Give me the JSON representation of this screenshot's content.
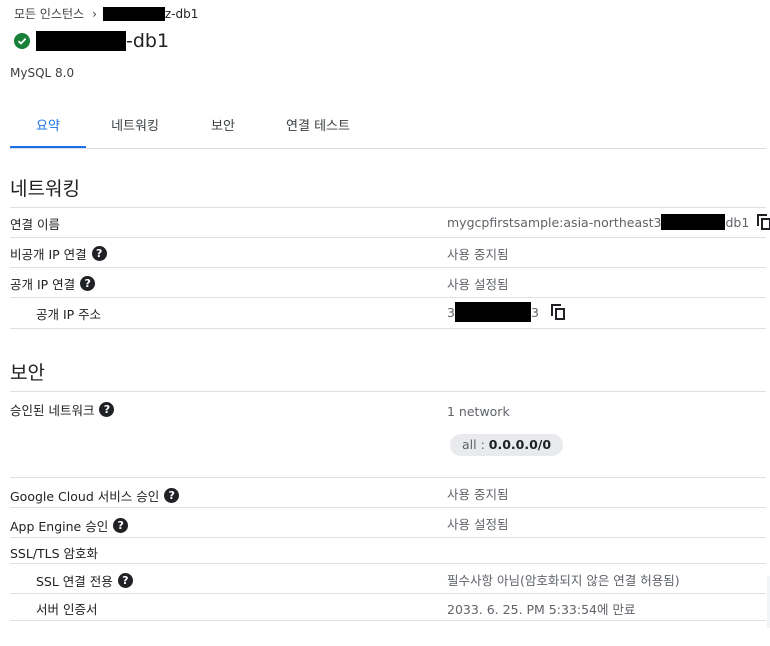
{
  "breadcrumb": {
    "root": "모든 인스턴스",
    "separator": "›",
    "current_suffix": "z-db1"
  },
  "instance": {
    "status_icon": "check-circle-icon",
    "status_color": "#188038",
    "name_suffix": "-db1",
    "db_version": "MySQL 8.0"
  },
  "tabs": [
    {
      "label": "요약",
      "active": true
    },
    {
      "label": "네트워킹",
      "active": false
    },
    {
      "label": "보안",
      "active": false
    },
    {
      "label": "연결 테스트",
      "active": false
    }
  ],
  "networking": {
    "title": "네트워킹",
    "connection_name": {
      "label": "연결 이름",
      "value_prefix": "mygcpfirstsample:asia-northeast3",
      "value_suffix": "db1"
    },
    "private_ip": {
      "label": "비공개 IP 연결",
      "value": "사용 중지됨"
    },
    "public_ip": {
      "label": "공개 IP 연결",
      "value": "사용 설정됨"
    },
    "public_ip_address": {
      "label": "공개 IP 주소",
      "value_prefix": "3",
      "value_suffix": "3"
    }
  },
  "security": {
    "title": "보안",
    "authorized_networks": {
      "label": "승인된 네트워크",
      "count": "1 network",
      "chip_name": "all : ",
      "chip_value": "0.0.0.0/0"
    },
    "google_cloud_auth": {
      "label": "Google Cloud 서비스 승인",
      "value": "사용 중지됨"
    },
    "app_engine_auth": {
      "label": "App Engine 승인",
      "value": "사용 설정됨"
    },
    "ssl_tls": {
      "label": "SSL/TLS 암호화"
    },
    "ssl_only": {
      "label": "SSL 연결 전용",
      "value": "필수사항 아님(암호화되지 않은 연결 허용됨)"
    },
    "server_cert": {
      "label": "서버 인증서",
      "value": "2033. 6. 25. PM 5:33:54에 만료"
    }
  },
  "colors": {
    "accent": "#1a73e8",
    "status_ok": "#188038"
  },
  "icons": {
    "help": "help-icon",
    "copy": "copy-icon"
  }
}
